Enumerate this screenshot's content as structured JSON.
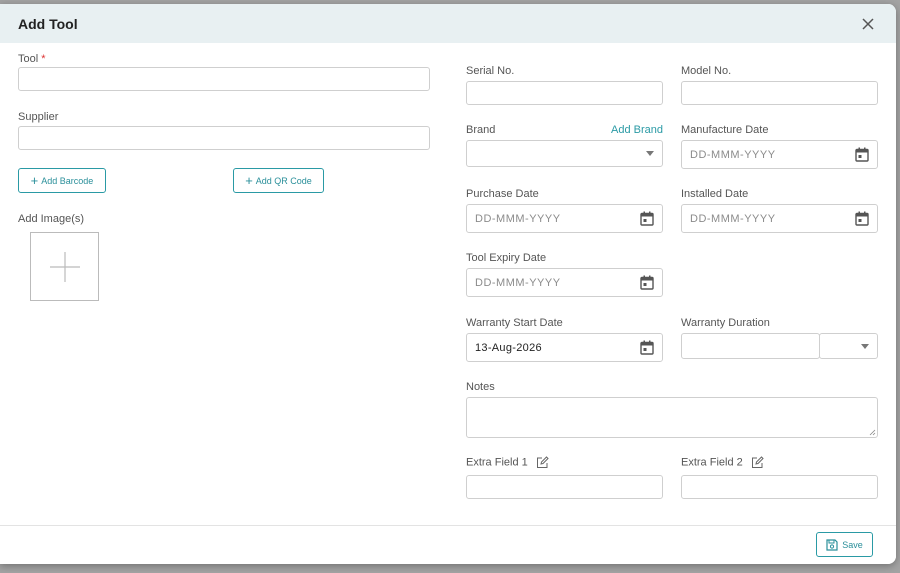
{
  "header": {
    "title": "Add Tool"
  },
  "left": {
    "tool_label": "Tool",
    "tool_required": "*",
    "supplier_label": "Supplier",
    "add_barcode_label": "Add Barcode",
    "add_qr_label": "Add QR Code",
    "add_images_label": "Add Image(s)"
  },
  "right": {
    "serial_label": "Serial No.",
    "model_label": "Model No.",
    "brand_label": "Brand",
    "add_brand_label": "Add Brand",
    "manufacture_label": "Manufacture Date",
    "manufacture_placeholder": "DD-MMM-YYYY",
    "purchase_label": "Purchase Date",
    "purchase_placeholder": "DD-MMM-YYYY",
    "installed_label": "Installed Date",
    "installed_placeholder": "DD-MMM-YYYY",
    "expiry_label": "Tool Expiry Date",
    "expiry_placeholder": "DD-MMM-YYYY",
    "warranty_start_label": "Warranty Start Date",
    "warranty_start_value": "13-Aug-2026",
    "warranty_duration_label": "Warranty Duration",
    "notes_label": "Notes",
    "extra1_label": "Extra Field 1",
    "extra2_label": "Extra Field 2"
  },
  "footer": {
    "save_label": "Save"
  },
  "icons": {
    "close": "close-icon",
    "calendar": "calendar-icon",
    "plus": "plus-icon",
    "edit": "edit-icon",
    "save": "save-icon",
    "caret": "chevron-down-icon"
  },
  "colors": {
    "accent": "#2a9aa5",
    "header_bg": "#e8f0f2",
    "required": "#d33333"
  }
}
